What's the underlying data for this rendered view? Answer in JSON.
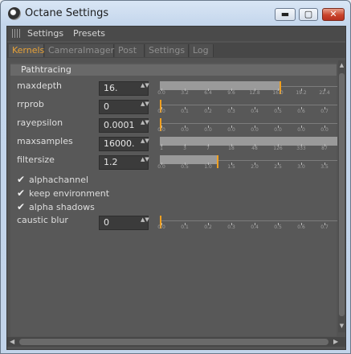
{
  "window": {
    "title": "Octane Settings",
    "min_glyph": "▬",
    "max_glyph": "▢",
    "close_glyph": "✕"
  },
  "menubar": {
    "items": [
      "Settings",
      "Presets"
    ]
  },
  "tabs": [
    "Kernels",
    "CameraImager",
    "Post",
    "Settings",
    "Log"
  ],
  "active_tab": "Kernels",
  "section": {
    "title": "Pathtracing"
  },
  "params": [
    {
      "label": "maxdepth",
      "value": "16.",
      "ticks": [
        "0.0",
        "3.2",
        "6.4",
        "9.6",
        "12.8",
        "16.0",
        "19.2",
        "22.4"
      ],
      "fill": 0.675,
      "handle": 0.675
    },
    {
      "label": "rrprob",
      "value": "0",
      "ticks": [
        "0.0",
        "0.1",
        "0.2",
        "0.3",
        "0.4",
        "0.5",
        "0.6",
        "0.7"
      ],
      "fill": 0.0,
      "handle": 0.0
    },
    {
      "label": "rayepsilon",
      "value": "0.0001",
      "ticks": [
        "0.0",
        "0.0",
        "0.0",
        "0.0",
        "0.0",
        "0.0",
        "0.0",
        "0.0"
      ],
      "fill": 0.0,
      "handle": 0.0
    },
    {
      "label": "maxsamples",
      "value": "16000.",
      "ticks": [
        "1",
        "3",
        "7",
        "18",
        "48",
        "126",
        "333",
        "87"
      ],
      "fill": 1.0,
      "handle": null
    },
    {
      "label": "filtersize",
      "value": "1.2",
      "ticks": [
        "0.0",
        "0.5",
        "1.0",
        "1.5",
        "2.0",
        "2.5",
        "3.0",
        "3.5"
      ],
      "fill": 0.32,
      "handle": 0.32
    }
  ],
  "checkboxes": [
    {
      "label": "alphachannel",
      "checked": true
    },
    {
      "label": "keep environment",
      "checked": true
    },
    {
      "label": "alpha shadows",
      "checked": true
    }
  ],
  "caustic": {
    "label": "caustic blur",
    "value": "0",
    "ticks": [
      "0.0",
      "0.1",
      "0.2",
      "0.3",
      "0.4",
      "0.5",
      "0.6",
      "0.7"
    ],
    "fill": 0.0,
    "handle": 0.0
  },
  "glyphs": {
    "check": "✔",
    "spin": "▲▼",
    "scroll_up": "▲",
    "scroll_down": "▼",
    "scroll_left": "◀",
    "scroll_right": "▶"
  },
  "colors": {
    "accent": "#e7a238",
    "handle": "#f0a020",
    "panel": "#585858"
  }
}
